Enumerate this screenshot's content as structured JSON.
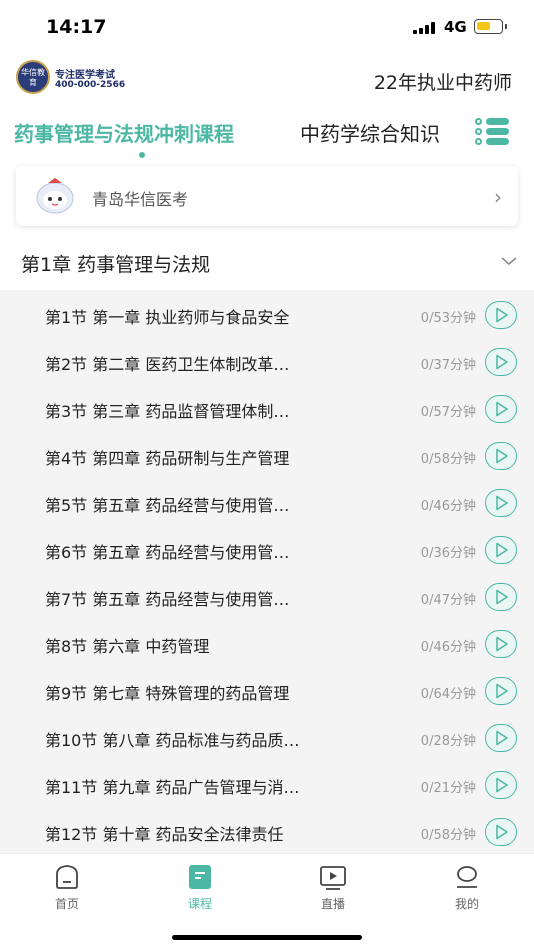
{
  "status_bar": {
    "time": "14:17",
    "network": "4G",
    "battery_level": 0.6
  },
  "header": {
    "logo_line1": "专注医学考试",
    "logo_line2": "400-000-2566",
    "logo_badge": "华信教育",
    "exam_title": "22年执业中药师"
  },
  "tabs": [
    {
      "label": "药事管理与法规冲刺课程",
      "active": true
    },
    {
      "label": "中药学综合知识",
      "active": false
    }
  ],
  "institution": {
    "name": "青岛华信医考"
  },
  "chapter": {
    "title": "第1章 药事管理与法规"
  },
  "lessons": [
    {
      "title": "第1节 第一章 执业药师与食品安全",
      "duration": "0/53分钟"
    },
    {
      "title": "第2节 第二章 医药卫生体制改革…",
      "duration": "0/37分钟"
    },
    {
      "title": "第3节 第三章 药品监督管理体制…",
      "duration": "0/57分钟"
    },
    {
      "title": "第4节 第四章 药品研制与生产管理",
      "duration": "0/58分钟"
    },
    {
      "title": "第5节 第五章 药品经营与使用管…",
      "duration": "0/46分钟"
    },
    {
      "title": "第6节 第五章 药品经营与使用管…",
      "duration": "0/36分钟"
    },
    {
      "title": "第7节 第五章 药品经营与使用管…",
      "duration": "0/47分钟"
    },
    {
      "title": "第8节 第六章 中药管理",
      "duration": "0/46分钟"
    },
    {
      "title": "第9节 第七章 特殊管理的药品管理",
      "duration": "0/64分钟"
    },
    {
      "title": "第10节 第八章 药品标准与药品质…",
      "duration": "0/28分钟"
    },
    {
      "title": "第11节 第九章 药品广告管理与消…",
      "duration": "0/21分钟"
    },
    {
      "title": "第12节 第十章 药品安全法律责任",
      "duration": "0/58分钟"
    }
  ],
  "bottom_nav": [
    {
      "label": "首页",
      "icon": "home-icon",
      "active": false
    },
    {
      "label": "课程",
      "icon": "course-icon",
      "active": true
    },
    {
      "label": "直播",
      "icon": "live-icon",
      "active": false
    },
    {
      "label": "我的",
      "icon": "profile-icon",
      "active": false
    }
  ],
  "colors": {
    "accent": "#4cb8a4",
    "list_background": "#f4f4f4"
  }
}
